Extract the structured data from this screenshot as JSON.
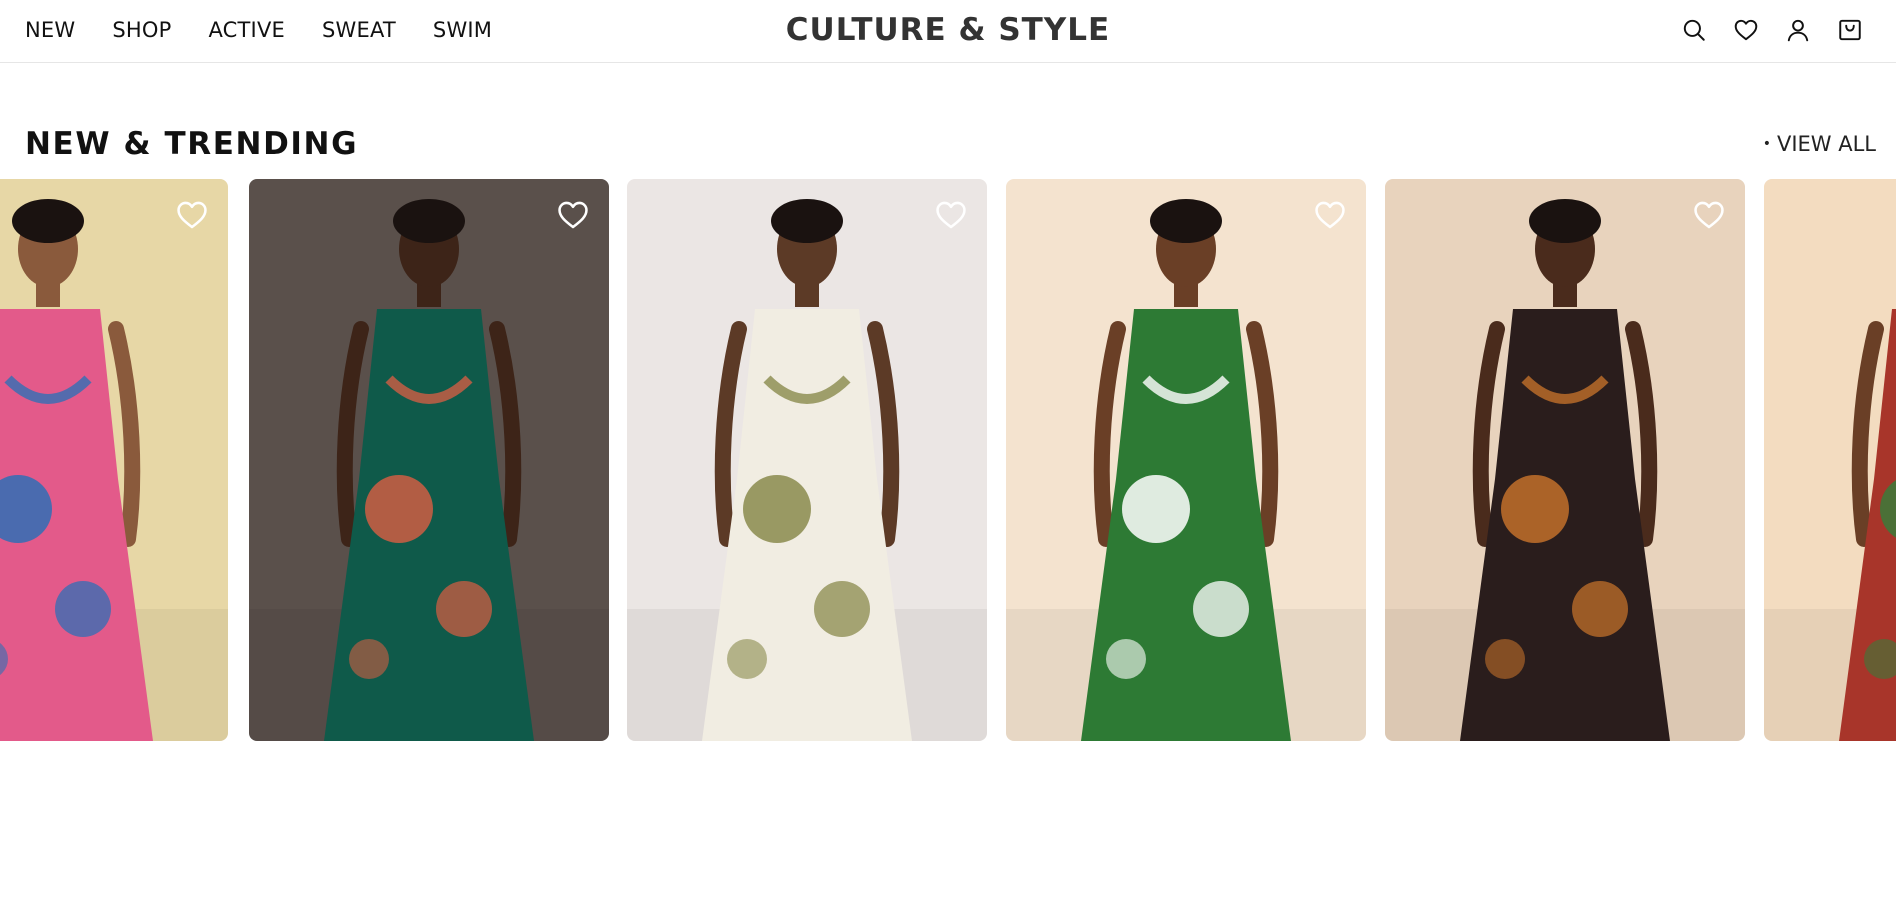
{
  "nav": {
    "items": [
      "NEW",
      "SHOP",
      "ACTIVE",
      "SWEAT",
      "SWIM"
    ]
  },
  "brand": "CULTURE & STYLE",
  "header_icons": [
    "search-icon",
    "heart-icon",
    "account-icon",
    "bag-icon"
  ],
  "section": {
    "title": "NEW & TRENDING",
    "view_all_bullet": "•",
    "view_all": "VIEW ALL"
  },
  "products": [
    {
      "name": "patchwork-print-maxi-dress",
      "bg": "#e7d7a6",
      "garment": "#e35a8a",
      "accent": "#2f6fb5",
      "skin": "#8a5a3c"
    },
    {
      "name": "green-tie-dye-maxi-dress",
      "bg": "#5a504b",
      "garment": "#0f5a4a",
      "accent": "#cf5e43",
      "skin": "#3d2418"
    },
    {
      "name": "olive-palm-print-set",
      "bg": "#ebe6e4",
      "garment": "#f1ede2",
      "accent": "#8a8a4c",
      "skin": "#5c3a26"
    },
    {
      "name": "green-leaf-print-romper",
      "bg": "#f4e3cf",
      "garment": "#2d7a34",
      "accent": "#ffffff",
      "skin": "#6a3f26"
    },
    {
      "name": "black-tropical-print-jumpsuit",
      "bg": "#e8d3bd",
      "garment": "#2a1d1c",
      "accent": "#c2702a",
      "skin": "#4a2b1c"
    },
    {
      "name": "red-print-dress",
      "bg": "#f3dcc0",
      "garment": "#a8352a",
      "accent": "#3b7a3a",
      "skin": "#6a3f26"
    }
  ],
  "colors": {
    "text": "#111111",
    "brand": "#333333",
    "divider": "#e6e6e6",
    "fav_icon": "#ffffff"
  }
}
